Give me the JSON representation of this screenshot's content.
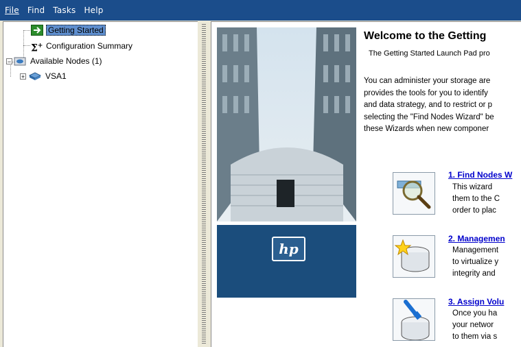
{
  "menu": [
    {
      "label": "File",
      "underline_index": 0
    },
    {
      "label": "Find",
      "underline_index": 1
    },
    {
      "label": "Tasks",
      "underline_index": 0
    },
    {
      "label": "Help",
      "underline_index": 0
    }
  ],
  "tree": {
    "items": [
      {
        "label": "Getting Started",
        "icon": "arrow-right-icon",
        "selected": true
      },
      {
        "label": "Configuration Summary",
        "icon": "sigma-plus-icon"
      },
      {
        "label": "Available Nodes (1)",
        "icon": "disk-group-icon"
      },
      {
        "label": "VSA1",
        "icon": "storage-node-icon"
      }
    ]
  },
  "welcome": {
    "title": "Welcome to the Getting",
    "subtitle": "The Getting Started Launch Pad pro",
    "body_lines": [
      "You can administer your storage are",
      "provides the tools for you to identify",
      "and data strategy, and to restrict or p",
      "selecting the \"Find Nodes Wizard\" be",
      "these Wizards when new componer"
    ],
    "logo_text": "hp"
  },
  "wizards": [
    {
      "title": "1. Find Nodes W",
      "icon": "magnifier-icon",
      "lines": [
        "This wizard",
        "them to the C",
        "order to plac"
      ]
    },
    {
      "title": "2. Managemen",
      "icon": "new-disk-icon",
      "lines": [
        "Management",
        "to virtualize y",
        "integrity and"
      ]
    },
    {
      "title": "3. Assign Volu",
      "icon": "network-disk-icon",
      "lines": [
        "Once you ha",
        "your networ",
        "to them via s"
      ]
    }
  ],
  "colors": {
    "menubar": "#1b4d8b",
    "link": "#0000cc",
    "selection": "#5f8fcf",
    "hp_panel": "#1b4d7c"
  }
}
